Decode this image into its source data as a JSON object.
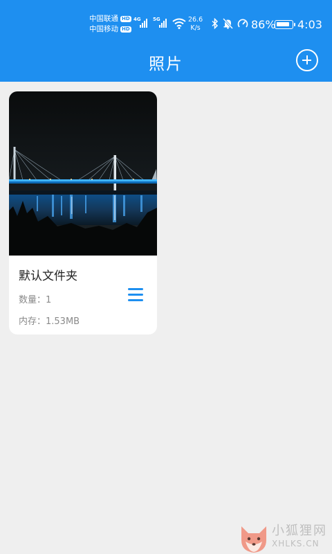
{
  "status_bar": {
    "carrier_1": "中国联通",
    "carrier_2": "中国移动",
    "hd_label": "HD",
    "network_1": "4G",
    "network_2": "5G",
    "speed_value": "26.6",
    "speed_unit": "K/s",
    "battery_percent": "86%",
    "battery_level": 0.86,
    "time": "4:03",
    "icons": [
      "wifi-icon",
      "bluetooth-icon",
      "mute-bell-icon",
      "speedometer-icon",
      "battery-charging-icon"
    ]
  },
  "header": {
    "title": "照片",
    "add_icon": "plus-circle-icon",
    "background_color": "#1e8ff0"
  },
  "albums": [
    {
      "name": "默认文件夹",
      "count_text": "数量：1",
      "size_text": "内存：1.53MB",
      "menu_icon": "hamburger-menu-icon",
      "thumbnail": "night-bridge-photo"
    }
  ],
  "watermark": {
    "text": "小狐狸网",
    "subtext": "XHLKS.CN",
    "icon": "fox-logo-icon"
  }
}
